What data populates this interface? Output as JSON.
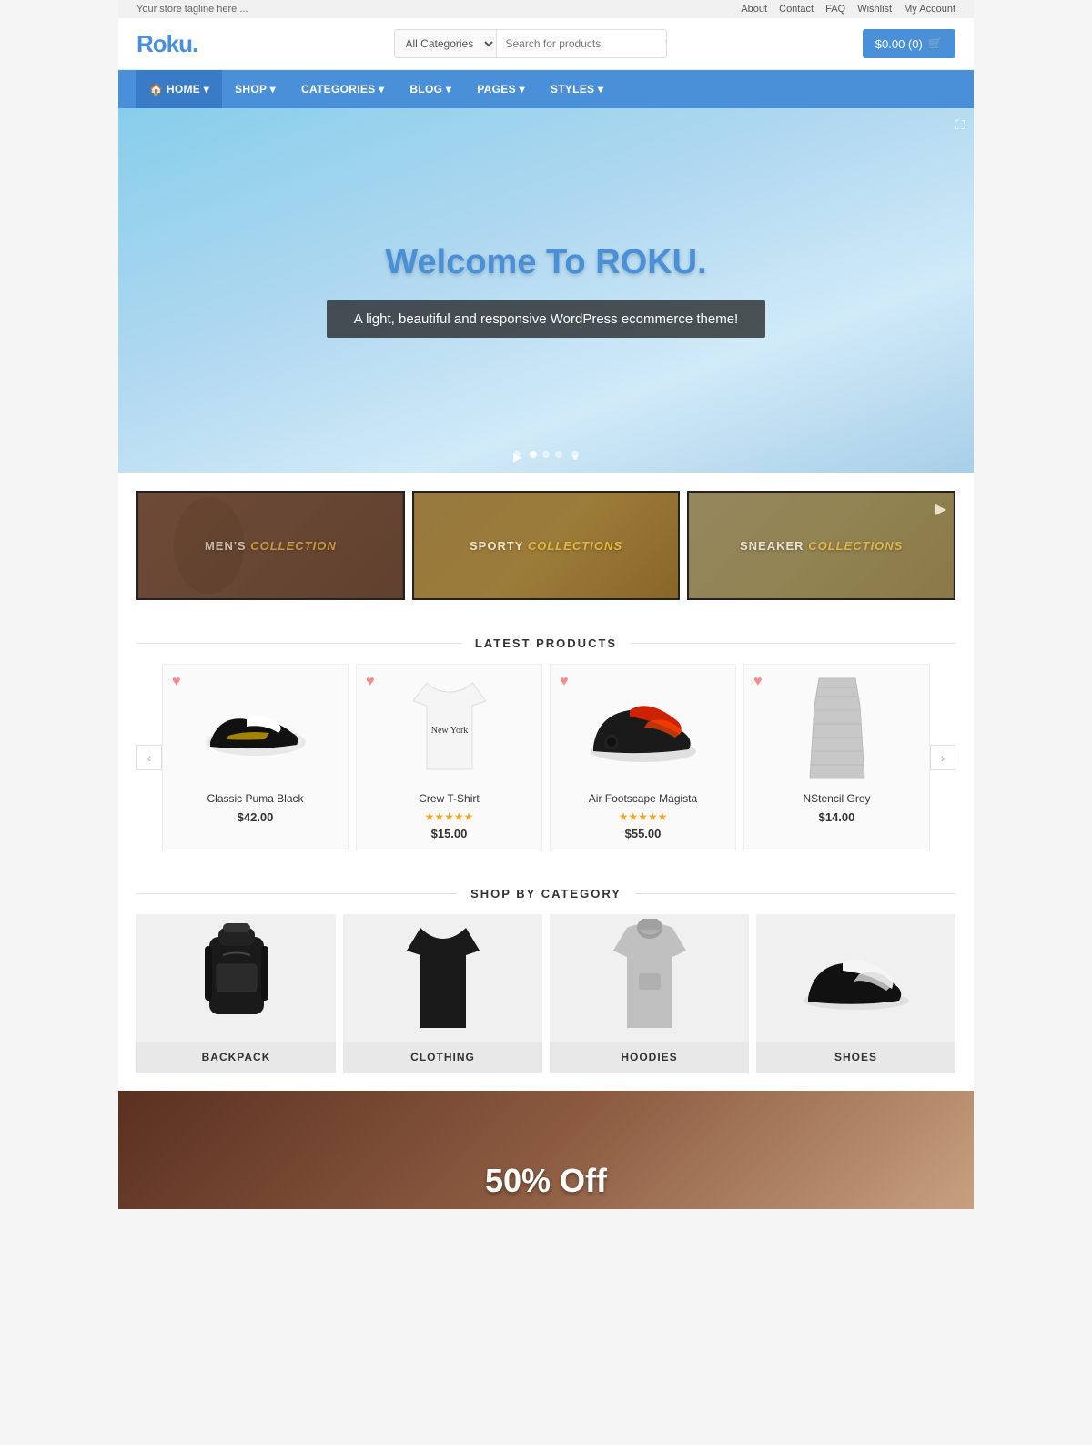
{
  "topbar": {
    "tagline": "Your store tagline here ...",
    "links": [
      "About",
      "Contact",
      "FAQ",
      "Wishlist",
      "My Account"
    ]
  },
  "header": {
    "logo": "Roku",
    "logo_dot": ".",
    "search": {
      "category_placeholder": "All Categories",
      "input_placeholder": "Search for products"
    },
    "cart": {
      "label": "$0.00 (0)",
      "icon": "🛒"
    }
  },
  "nav": {
    "items": [
      {
        "label": "HOME",
        "icon": "🏠",
        "active": true
      },
      {
        "label": "SHOP",
        "has_dropdown": true
      },
      {
        "label": "CATEGORIES",
        "has_dropdown": true
      },
      {
        "label": "BLOG",
        "has_dropdown": true
      },
      {
        "label": "PAGES",
        "has_dropdown": true
      },
      {
        "label": "STYLES",
        "has_dropdown": true
      }
    ]
  },
  "hero": {
    "title": "Welcome To ROKU",
    "title_dot": ".",
    "subtitle": "A light, beautiful and responsive WordPress ecommerce theme!"
  },
  "collections": [
    {
      "id": "mens",
      "label_plain": "MEN'S",
      "label_italic": "COLLECTION",
      "has_border": true
    },
    {
      "id": "sporty",
      "label_plain": "SPORTY",
      "label_italic": "COLLECTIONS",
      "has_play": false
    },
    {
      "id": "sneaker",
      "label_plain": "SNEAKER",
      "label_italic": "COLLECTIONS",
      "has_play": true
    }
  ],
  "latest_products": {
    "section_label": "LATEST PRODUCTS",
    "items": [
      {
        "name": "Classic Puma Black",
        "price": "$42.00",
        "stars": 0,
        "has_stars": false
      },
      {
        "name": "Crew T-Shirt",
        "price": "$15.00",
        "stars": 5,
        "has_stars": true
      },
      {
        "name": "Air Footscape Magista",
        "price": "$55.00",
        "stars": 5,
        "has_stars": true
      },
      {
        "name": "NStencil Grey",
        "price": "$14.00",
        "stars": 0,
        "has_stars": false
      }
    ]
  },
  "shop_by_category": {
    "section_label": "SHOP BY CATEGORY",
    "items": [
      {
        "label": "BACKPACK"
      },
      {
        "label": "CLOTHING"
      },
      {
        "label": "HOODIES"
      },
      {
        "label": "SHOES"
      }
    ]
  },
  "footer_promo": {
    "text": "50% Off"
  }
}
